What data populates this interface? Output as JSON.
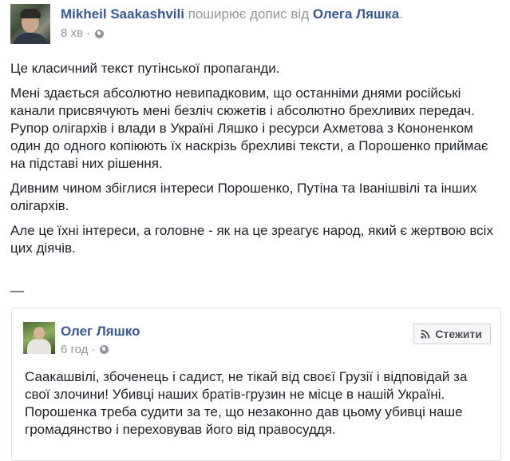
{
  "post": {
    "author": "Mikheil Saakashvili",
    "shares_text": "поширює допис від",
    "shared_from": "Олега Ляшка",
    "period": ".",
    "time": "8 хв",
    "separator": "·",
    "privacy_icon": "globe-icon",
    "paragraphs": [
      "Це класичний текст путінської пропаганди.",
      "Мені здається абсолютно невипадковим, що останніми днями російські канали присвячують мені безліч сюжетів і абсолютно брехливих передач. Рупор олігархів і влади в Україні Ляшко і ресурси Ахметова з Кононенком один до одного копіюють їх наскрізь брехливі тексти, а Порошенко приймає на підставі них рішення.",
      "Дивним чином збіглися інтереси Порошенко, Путіна та Іванішвілі та інших олігархів.",
      "Але це їхні інтереси, а головне - як на це зреагує народ, який є жертвою всіх цих діячів."
    ],
    "dash": "—"
  },
  "shared_post": {
    "author": "Олег Ляшко",
    "time": "6 год",
    "separator": "·",
    "privacy_icon": "globe-icon",
    "follow_icon": "rss-icon",
    "follow_label": "Стежити",
    "text": "Саакашвілі, збоченець і садист, не тікай від своєї Грузії і відповідай за свої злочини! Убивці наших братів-грузин не місце в нашій Україні. Порошенка треба судити за те, що незаконно дав цьому убивці наше громадянство і переховував його від правосуддя."
  }
}
